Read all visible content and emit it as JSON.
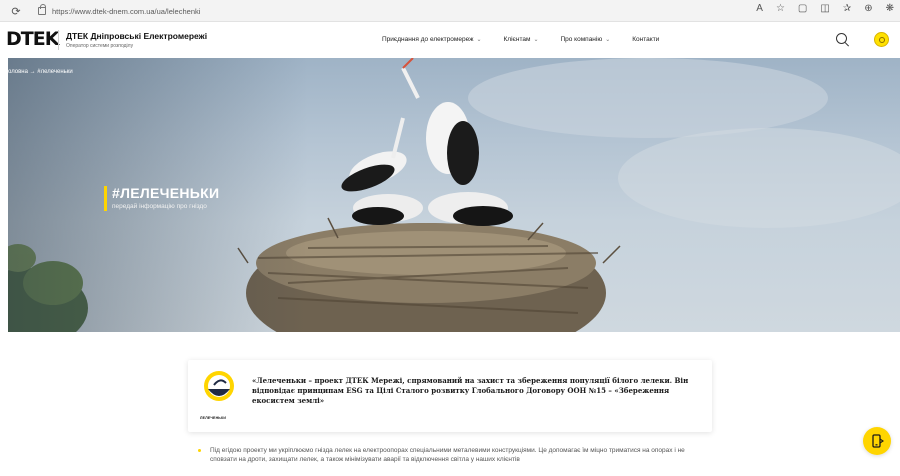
{
  "browser": {
    "url": "https://www.dtek-dnem.com.ua/ua/lelechenki"
  },
  "header": {
    "logo": "DTEK",
    "brand_title": "ДТЕК Дніпровські Електромережі",
    "brand_subtitle": "Оператор системи розподілу",
    "nav": [
      {
        "label": "Приєднання до електромереж",
        "has_dropdown": true
      },
      {
        "label": "Клієнтам",
        "has_dropdown": true
      },
      {
        "label": "Про компанію",
        "has_dropdown": true
      },
      {
        "label": "Контакти",
        "has_dropdown": false
      }
    ]
  },
  "hero": {
    "breadcrumb": "оловна → #лелеченьки",
    "title": "#ЛЕЛЕЧЕНЬКИ",
    "subtitle": "передай інформацію про гніздо"
  },
  "intro": {
    "logo_caption": "ЛЕЛЕЧЕНЬКИ",
    "text": "«Лелеченьки – проект ДТЕК Мережі, спрямований на захист та збереження популяції білого лелеки. Він відповідає принципам ESG та Цілі Сталого розвитку Глобального Договору ООН №15 – «Збереження екосистем землі»"
  },
  "bullets": [
    "Під егідою проекту ми укріплюємо гнізда лелек на електроопорах спеціальними металевими конструкціями. Це допомагає їм міцно триматися на опорах і не сповзати на дроти, захищати лелек, а також мінімізувати аварії та відключення світла у наших клієнтів"
  ],
  "colors": {
    "accent": "#ffd500",
    "text": "#1a1a1a"
  }
}
